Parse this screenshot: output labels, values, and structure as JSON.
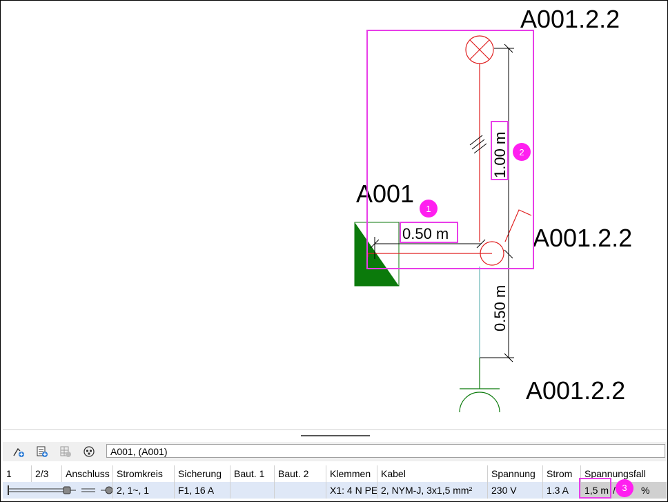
{
  "drawing": {
    "labels": {
      "top_right": "A001.2.2",
      "main": "A001",
      "mid_right": "A001.2.2",
      "bottom_right": "A001.2.2"
    },
    "dimensions": {
      "horizontal": "0.50 m",
      "vertical_upper": "1.00 m",
      "vertical_lower": "0.50 m"
    },
    "markers": [
      "1",
      "2",
      "3"
    ],
    "colors": {
      "circuit_red": "#e02020",
      "symbol_green": "#0b7a0b",
      "highlight_magenta": "#e83ee8",
      "badge_magenta": "#ff1ff0"
    }
  },
  "toolbar": {
    "icons": [
      "add-device-icon",
      "add-list-icon",
      "grid-disabled-icon",
      "circuit-icon"
    ],
    "path_value": "A001,  (A001)"
  },
  "table": {
    "headers": [
      "1",
      "2/3",
      "Anschluss",
      "Stromkreis",
      "Sicherung",
      "Baut. 1",
      "Baut. 2",
      "Klemmen",
      "Kabel",
      "Spannung",
      "Strom",
      "Spannungsfall"
    ],
    "row": {
      "stromkreis": "2, 1~, 1",
      "sicherung": "F1, 16 A",
      "baut1": "",
      "baut2": "",
      "klemmen": "X1: 4 N PE",
      "kabel": "2, NYM-J, 3x1,5 mm²",
      "spannung": "230 V",
      "strom": "1.3 A",
      "spannungsfall_length": "1,5 m",
      "spannungsfall_sep": "/",
      "spannungsfall_unit": "%"
    }
  }
}
